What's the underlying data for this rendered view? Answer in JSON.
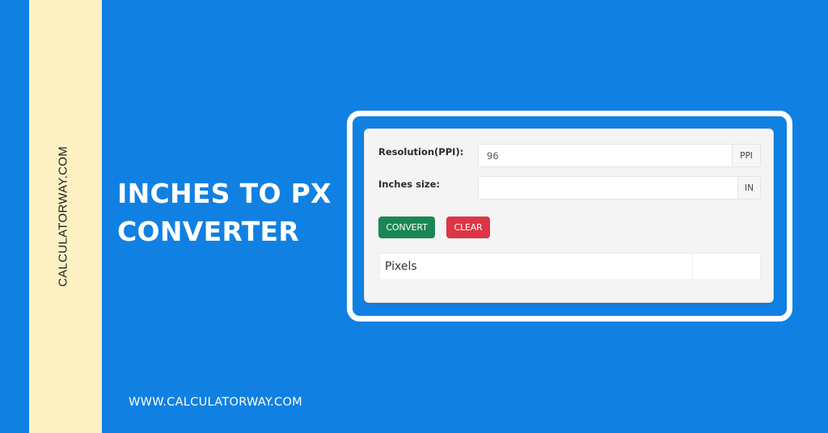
{
  "branding": {
    "side_text": "CALCULATORWAY.COM",
    "website_url": "WWW.CALCULATORWAY.COM"
  },
  "headline": {
    "line1": "INCHES TO PX",
    "line2": "CONVERTER"
  },
  "form": {
    "resolution": {
      "label": "Resolution(PPI):",
      "value": "96",
      "unit": "PPI"
    },
    "inches": {
      "label": "Inches size:",
      "value": "",
      "unit": "IN"
    },
    "buttons": {
      "convert": "CONVERT",
      "clear": "CLEAR"
    },
    "result": {
      "label": "Pixels",
      "value": ""
    }
  },
  "colors": {
    "background": "#1081e2",
    "side_strip": "#fdf1c4",
    "convert_button": "#198754",
    "clear_button": "#dc3545"
  }
}
